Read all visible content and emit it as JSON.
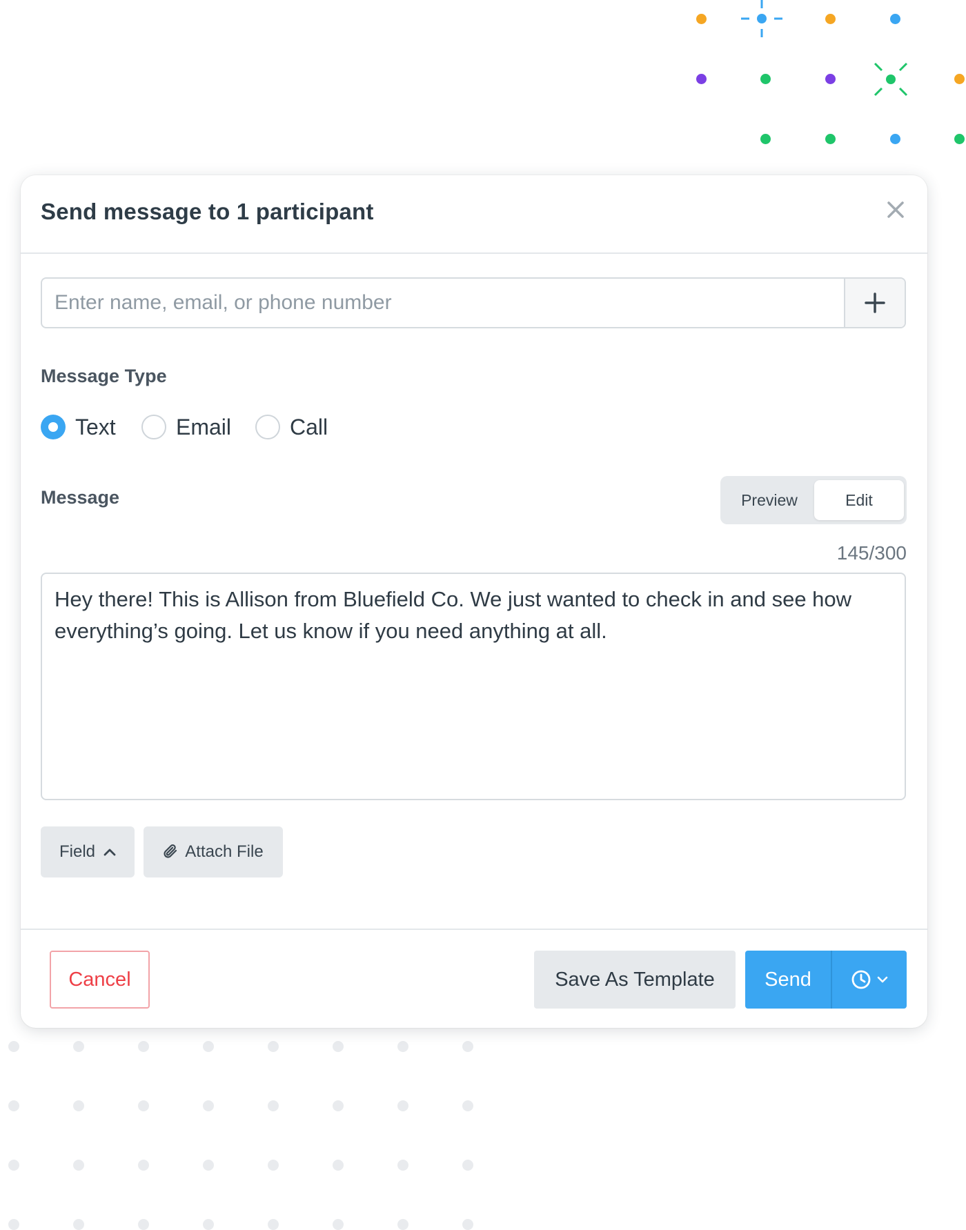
{
  "modal": {
    "title": "Send message to 1 participant"
  },
  "recipient": {
    "placeholder": "Enter name, email, or phone number",
    "add_icon": "plus-icon"
  },
  "message_type": {
    "label": "Message Type",
    "options": [
      {
        "label": "Text",
        "checked": true
      },
      {
        "label": "Email",
        "checked": false
      },
      {
        "label": "Call",
        "checked": false
      }
    ]
  },
  "message": {
    "label": "Message",
    "mode_options": [
      "Preview",
      "Edit"
    ],
    "active_mode": "Edit",
    "char_count": "145/300",
    "body": "Hey there! This is Allison from Bluefield Co. We just wanted to check in and see how everything’s going. Let us know if you need anything at all."
  },
  "tools": {
    "field_label": "Field",
    "attach_label": "Attach File"
  },
  "footer": {
    "cancel_label": "Cancel",
    "save_template_label": "Save As Template",
    "send_label": "Send",
    "schedule_icon": "clock-icon"
  },
  "colors": {
    "accent": "#3aa6f2",
    "danger": "#ee3f46",
    "orange": "#f5a623",
    "purple": "#7b3fe4",
    "green": "#1fc56a"
  }
}
